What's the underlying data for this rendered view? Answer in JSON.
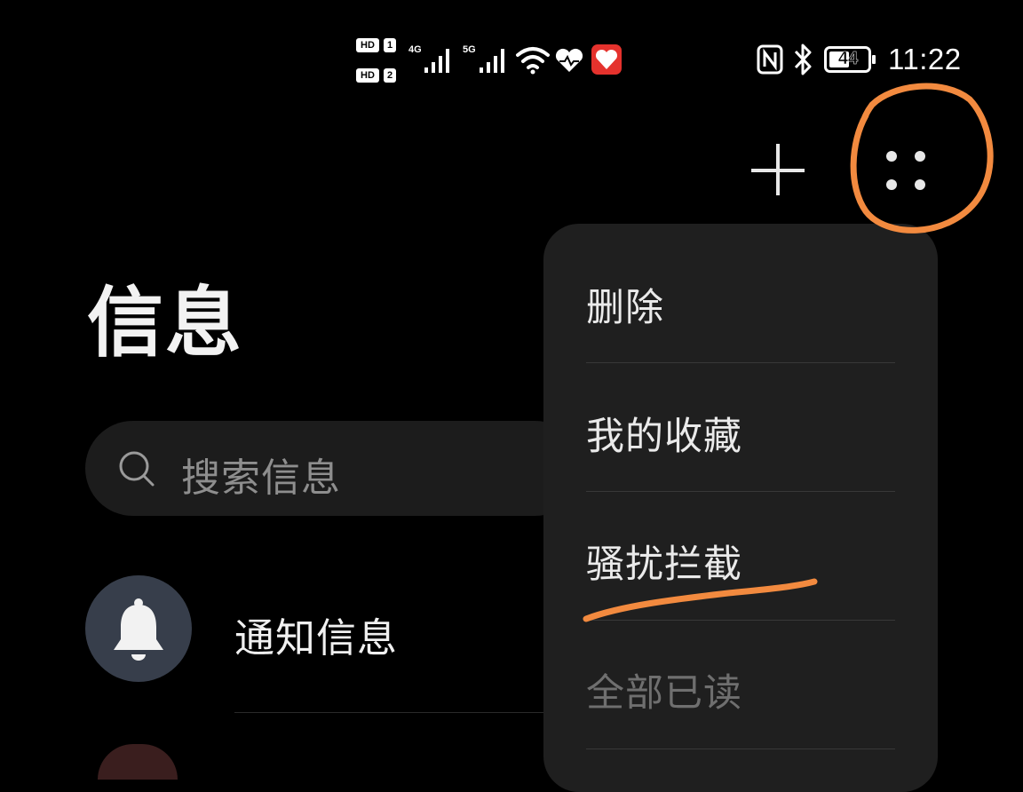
{
  "status_bar": {
    "hd1": "HD",
    "hd1_num": "1",
    "hd2": "HD",
    "hd2_num": "2",
    "net1": "4G",
    "net2": "5G",
    "battery": "44",
    "time": "11:22"
  },
  "header": {
    "add_icon": "plus-icon",
    "more_icon": "more-dots-icon"
  },
  "page": {
    "title": "信息"
  },
  "search": {
    "placeholder": "搜索信息",
    "icon": "search-icon"
  },
  "list": {
    "items": [
      {
        "title": "通知信息",
        "icon": "bell-icon"
      }
    ]
  },
  "menu": {
    "items": [
      {
        "label": "删除",
        "enabled": true
      },
      {
        "label": "我的收藏",
        "enabled": true
      },
      {
        "label": "骚扰拦截",
        "enabled": true
      },
      {
        "label": "全部已读",
        "enabled": false
      }
    ]
  },
  "annotation_color": "#f28a3f"
}
